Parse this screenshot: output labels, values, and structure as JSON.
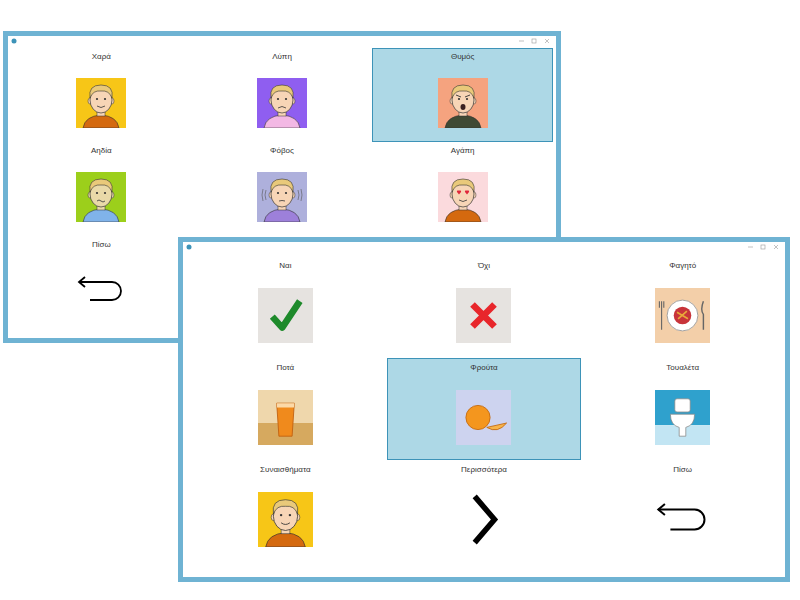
{
  "windows": [
    {
      "name": "emotions",
      "items": [
        {
          "label": "Χαρά",
          "kind": "joy",
          "selected": false
        },
        {
          "label": "Λύπη",
          "kind": "sadness",
          "selected": false
        },
        {
          "label": "Θυμός",
          "kind": "anger",
          "selected": true
        },
        {
          "label": "Αηδία",
          "kind": "disgust",
          "selected": false
        },
        {
          "label": "Φόβος",
          "kind": "fear",
          "selected": false
        },
        {
          "label": "Αγάπη",
          "kind": "love",
          "selected": false
        },
        {
          "label": "Πίσω",
          "kind": "back",
          "selected": false
        }
      ]
    },
    {
      "name": "main",
      "items": [
        {
          "label": "Ναι",
          "kind": "yes",
          "selected": false
        },
        {
          "label": "Όχι",
          "kind": "no",
          "selected": false
        },
        {
          "label": "Φαγητό",
          "kind": "food",
          "selected": false
        },
        {
          "label": "Ποτά",
          "kind": "drink",
          "selected": false
        },
        {
          "label": "Φρούτα",
          "kind": "fruit",
          "selected": true
        },
        {
          "label": "Τουαλέτα",
          "kind": "toilet",
          "selected": false
        },
        {
          "label": "Συναισθήματα",
          "kind": "emotions",
          "selected": false
        },
        {
          "label": "Περισσότερα",
          "kind": "more",
          "selected": false
        },
        {
          "label": "Πίσω",
          "kind": "back",
          "selected": false
        }
      ]
    }
  ]
}
